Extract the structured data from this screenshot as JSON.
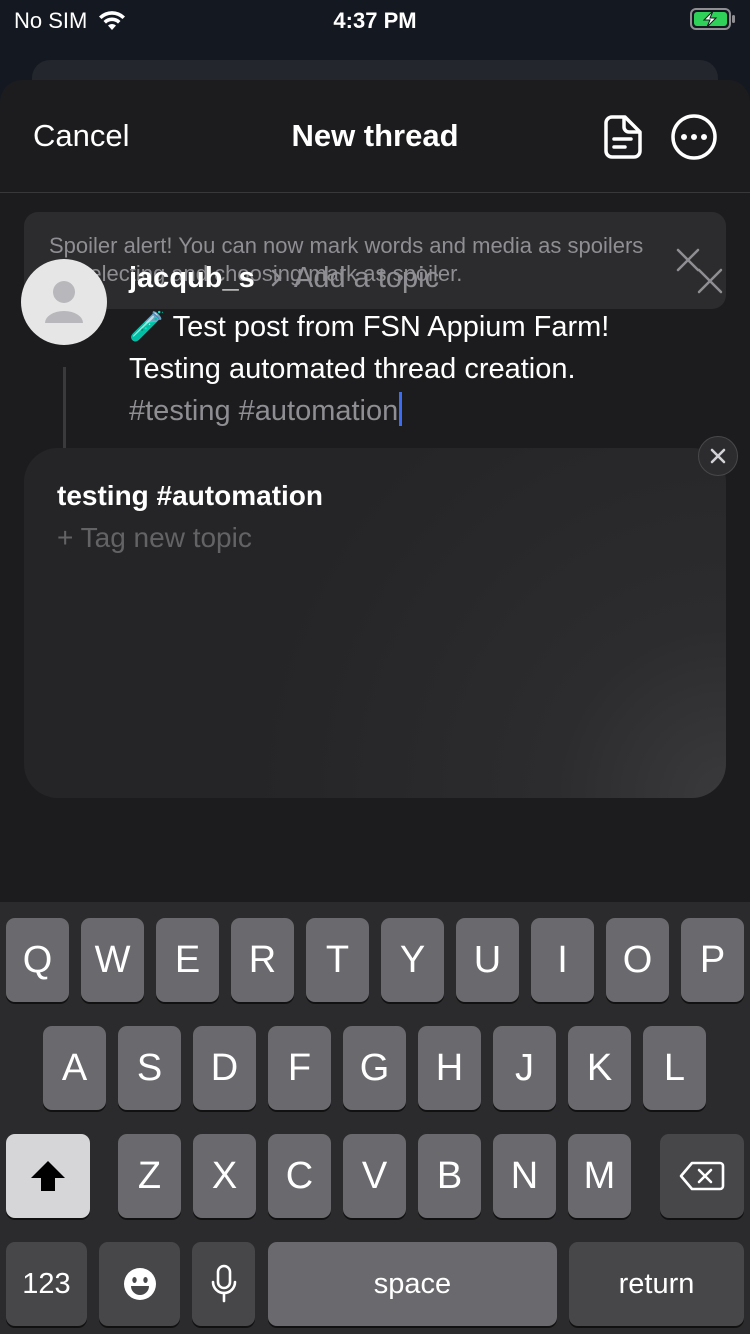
{
  "status_bar": {
    "carrier": "No SIM",
    "time": "4:37 PM"
  },
  "nav": {
    "cancel_label": "Cancel",
    "title": "New thread"
  },
  "alert": {
    "message": "Spoiler alert! You can now mark words and media as spoilers by selecting and choosing mark as spoiler."
  },
  "composer": {
    "username": "jacqub_s",
    "topic_placeholder": "Add a topic",
    "line1": "🧪 Test post from FSN Appium Farm!",
    "line2": "Testing automated thread creation.",
    "tags": "#testing #automation"
  },
  "topic_popup": {
    "suggestion": "testing #automation",
    "new_topic_label": "+ Tag new topic"
  },
  "keyboard": {
    "row1": [
      "Q",
      "W",
      "E",
      "R",
      "T",
      "Y",
      "U",
      "I",
      "O",
      "P"
    ],
    "row2": [
      "A",
      "S",
      "D",
      "F",
      "G",
      "H",
      "J",
      "K",
      "L"
    ],
    "row3": [
      "Z",
      "X",
      "C",
      "V",
      "B",
      "N",
      "M"
    ],
    "numbers_label": "123",
    "space_label": "space",
    "return_label": "return"
  },
  "colors": {
    "caret": "#3b6cf2",
    "battery": "#30d158",
    "sheet_bg": "#1c1c1e"
  }
}
